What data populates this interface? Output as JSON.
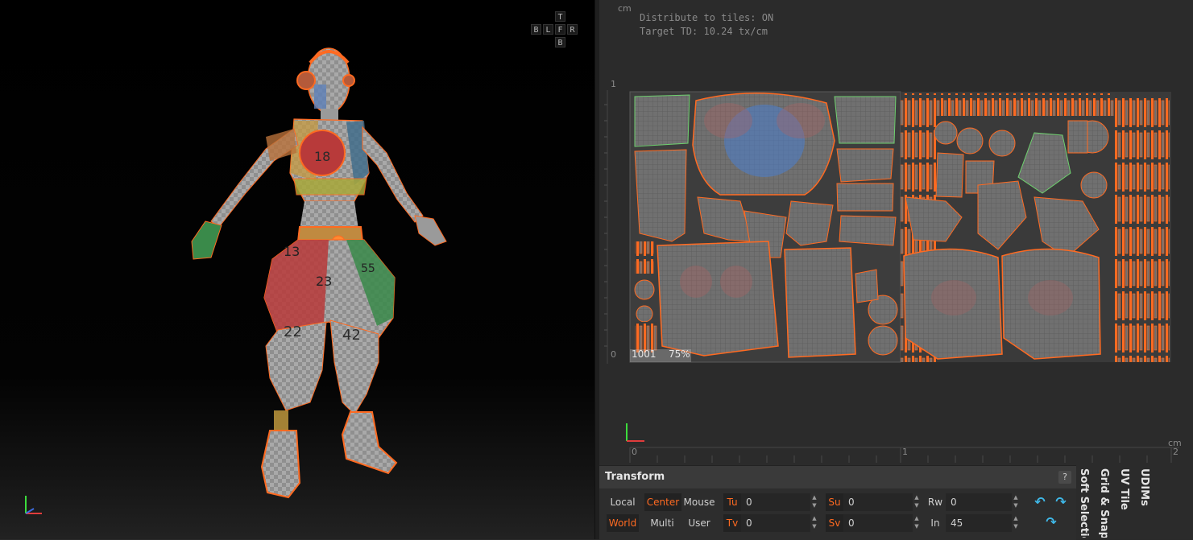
{
  "viewport3d": {
    "navcube": {
      "top": "T",
      "bottom": "B",
      "back": "B",
      "left": "L",
      "front": "F",
      "right": "R"
    }
  },
  "uv_editor": {
    "info_distribute": "Distribute to tiles: ON",
    "info_target_td": "Target TD: 10.24 tx/cm",
    "unit_top": "cm",
    "unit_right": "cm",
    "y_tick_1": "1",
    "y_tick_0": "0",
    "x_tick_0": "0",
    "x_tick_1": "1",
    "x_tick_2": "2",
    "tile_id": "1001",
    "tile_fill": "75%",
    "colors": {
      "seam": "#ff6a21",
      "island": "#6f6f6f",
      "tile_bg": "#3d3d3d",
      "stretch_blue": "#4a7fd0",
      "stretch_red": "#b06060",
      "edge_green": "#6ed06e"
    }
  },
  "transform": {
    "title": "Transform",
    "help": "?",
    "local": "Local",
    "center": "Center",
    "mouse": "Mouse",
    "world": "World",
    "multi": "Multi",
    "user": "User",
    "tu_label": "Tu",
    "tu_value": "0",
    "tv_label": "Tv",
    "tv_value": "0",
    "su_label": "Su",
    "su_value": "0",
    "sv_label": "Sv",
    "sv_value": "0",
    "rw_label": "Rw",
    "rw_value": "0",
    "in_label": "In",
    "in_value": "45",
    "rotate_ccw_icon": "rotate-left-icon",
    "rotate_cw_icon": "rotate-right-icon",
    "flip_icon": "rotate-down-icon"
  },
  "side_tabs": [
    "Soft Selectio",
    "Grid & Snap",
    "UV Tile",
    "UDIMs"
  ]
}
